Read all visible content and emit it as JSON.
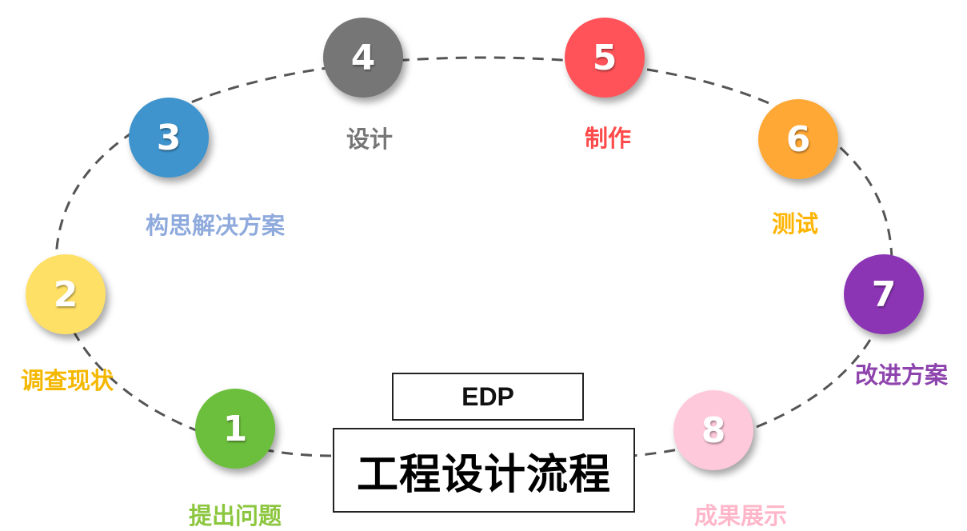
{
  "edp": "EDP",
  "title": "工程设计流程",
  "steps": [
    {
      "num": "1",
      "label": "提出问题",
      "color": "#6cbf3c",
      "label_color": "#8cc63f"
    },
    {
      "num": "2",
      "label": "调查现状",
      "color": "#ffe066",
      "label_color": "#f5b800"
    },
    {
      "num": "3",
      "label": "构思解决方案",
      "color": "#3f94cd",
      "label_color": "#8faadc"
    },
    {
      "num": "4",
      "label": "设计",
      "color": "#767676",
      "label_color": "#767676"
    },
    {
      "num": "5",
      "label": "制作",
      "color": "#ff5359",
      "label_color": "#ff4b4b"
    },
    {
      "num": "6",
      "label": "测试",
      "color": "#ffa835",
      "label_color": "#ffb400"
    },
    {
      "num": "7",
      "label": "改进方案",
      "color": "#8b35b5",
      "label_color": "#8e44ad"
    },
    {
      "num": "8",
      "label": "成果展示",
      "color": "#ffc9dc",
      "label_color": "#ffb6c9"
    }
  ]
}
